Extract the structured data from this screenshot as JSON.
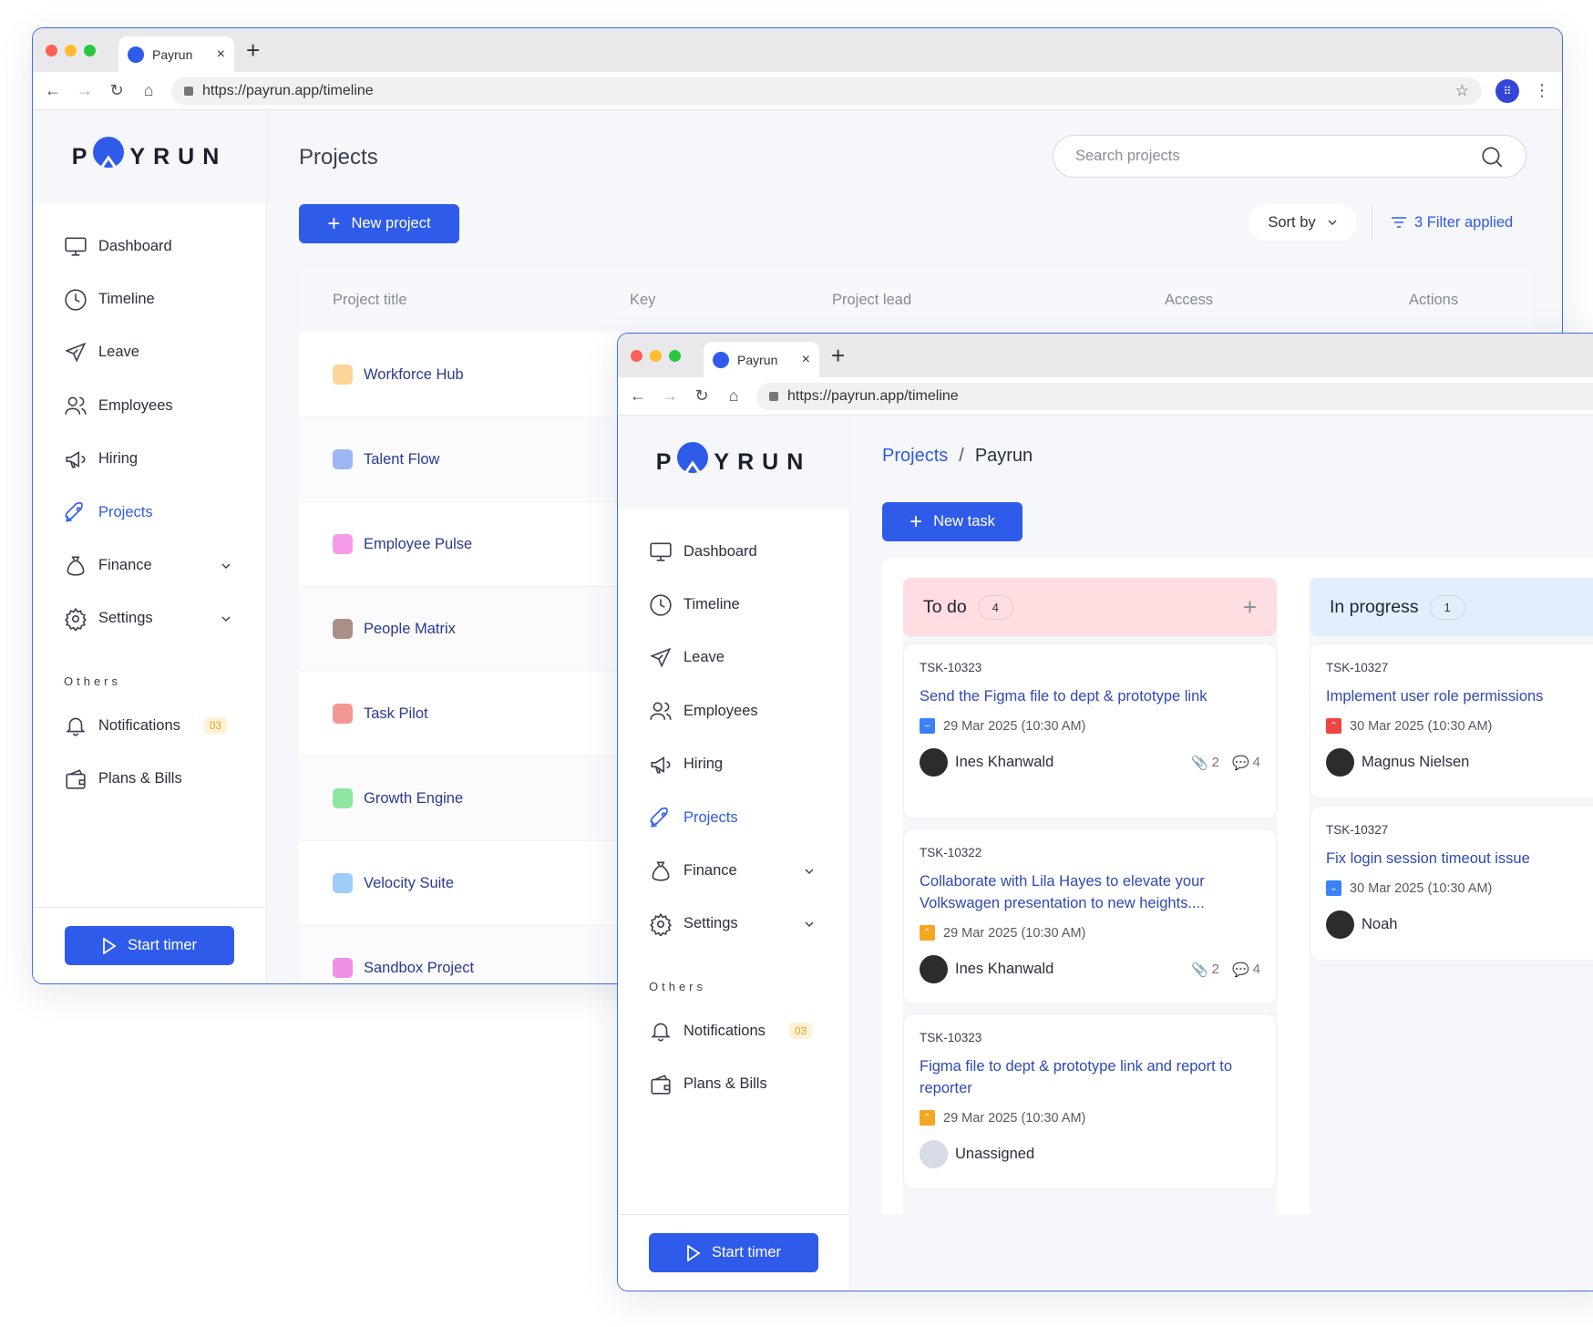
{
  "browser": {
    "tab_title": "Payrun",
    "url": "https://payrun.app/timeline",
    "new_tab_label": "+",
    "tab_close": "×"
  },
  "logo": {
    "before": "P",
    "after": "YRUN"
  },
  "sidebar": {
    "items": [
      {
        "label": "Dashboard"
      },
      {
        "label": "Timeline"
      },
      {
        "label": "Leave"
      },
      {
        "label": "Employees"
      },
      {
        "label": "Hiring"
      },
      {
        "label": "Projects"
      },
      {
        "label": "Finance"
      },
      {
        "label": "Settings"
      }
    ],
    "others_heading": "Others",
    "notifications_label": "Notifications",
    "notifications_badge": "03",
    "plans_label": "Plans & Bills",
    "start_timer": "Start timer"
  },
  "projects_page": {
    "title": "Projects",
    "search_placeholder": "Search projects",
    "new_project": "New project",
    "sort_by": "Sort by",
    "filter": "3 Filter applied",
    "columns": [
      "Project title",
      "Key",
      "Project lead",
      "Access",
      "Actions"
    ],
    "rows": [
      {
        "name": "Workforce Hub",
        "color": "#fcd59a"
      },
      {
        "name": "Talent Flow",
        "color": "#9db7f5"
      },
      {
        "name": "Employee Pulse",
        "color": "#f59be8"
      },
      {
        "name": "People Matrix",
        "color": "#a98f86"
      },
      {
        "name": "Task Pilot",
        "color": "#f59696"
      },
      {
        "name": "Growth Engine",
        "color": "#8ee6a2"
      },
      {
        "name": "Velocity Suite",
        "color": "#9fcdf7"
      },
      {
        "name": "Sandbox Project",
        "color": "#ef8fe6"
      }
    ]
  },
  "board_page": {
    "breadcrumb_root": "Projects",
    "breadcrumb_sep": "/",
    "breadcrumb_current": "Payrun",
    "new_task": "New task",
    "columns": [
      {
        "title": "To do",
        "count": "4",
        "color": "#ffdde1"
      },
      {
        "title": "In progress",
        "count": "1",
        "color": "#e1eefb"
      }
    ],
    "todo_cards": [
      {
        "id": "TSK-10323",
        "title": "Send the Figma file to dept & prototype link",
        "date": "29 Mar 2025 (10:30 AM)",
        "assignee": "Ines Khanwald",
        "attachments": "2",
        "comments": "4"
      },
      {
        "id": "TSK-10322",
        "title": "Collaborate with Lila Hayes to elevate your Volkswagen presentation to new heights....",
        "date": "29 Mar 2025 (10:30 AM)",
        "assignee": "Ines Khanwald",
        "attachments": "2",
        "comments": "4"
      },
      {
        "id": "TSK-10323",
        "title": "Figma file to dept & prototype link and report to reporter",
        "date": "29 Mar 2025 (10:30 AM)",
        "assignee": "Unassigned"
      }
    ],
    "progress_cards": [
      {
        "id": "TSK-10327",
        "title": "Implement user role permissions",
        "date": "30 Mar 2025 (10:30 AM)",
        "assignee": "Magnus Nielsen"
      },
      {
        "id": "TSK-10327",
        "title": "Fix login session timeout issue",
        "date": "30 Mar 2025 (10:30 AM)",
        "assignee": "Noah"
      }
    ]
  },
  "colors": {
    "accent": "#2f5bea",
    "badge": "#e4a321"
  }
}
